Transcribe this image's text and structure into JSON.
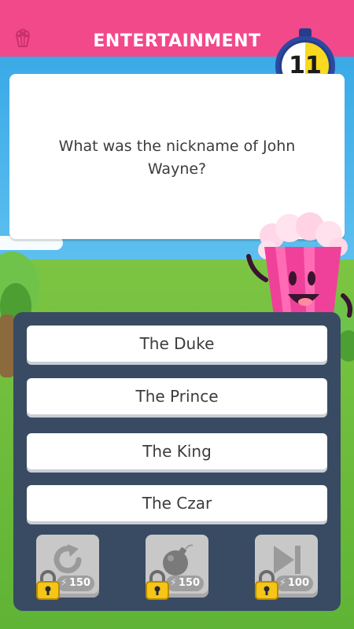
{
  "header": {
    "category": "ENTERTAINMENT",
    "category_icon": "popcorn-icon",
    "color": "#f2498b"
  },
  "timer": {
    "seconds": "11"
  },
  "question": {
    "text": "What was the nickname of John Wayne?"
  },
  "answers": [
    {
      "label": "The Duke"
    },
    {
      "label": "The Prince"
    },
    {
      "label": "The King"
    },
    {
      "label": "The Czar"
    }
  ],
  "powerups": [
    {
      "icon": "refresh-icon",
      "cost": "150",
      "locked": true
    },
    {
      "icon": "bomb-icon",
      "cost": "150",
      "locked": true
    },
    {
      "icon": "skip-icon",
      "cost": "100",
      "locked": true
    }
  ],
  "colors": {
    "panel": "#394a63",
    "timer_fill": "#f8d91f",
    "timer_ring": "#273d8a"
  }
}
